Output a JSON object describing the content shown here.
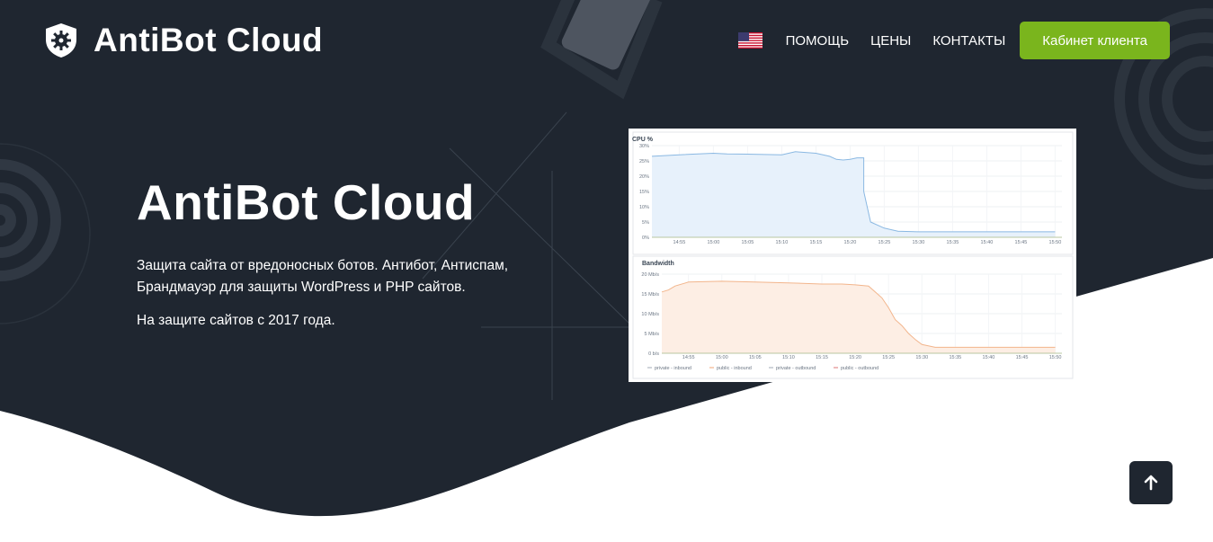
{
  "brand": {
    "name": "AntiBot Cloud",
    "icon": "shield-gear-icon"
  },
  "nav": {
    "language_icon": "us-flag-icon",
    "links": [
      "ПОМОЩЬ",
      "ЦЕНЫ",
      "КОНТАКТЫ"
    ],
    "cta_label": "Кабинет клиента"
  },
  "hero": {
    "title": "AntiBot Cloud",
    "description": "Защита сайта от вредоносных ботов. Антибот, Антиспам, Брандмауэр для защиты WordPress и PHP сайтов.",
    "since": "На защите сайтов с 2017 года."
  },
  "colors": {
    "dark_bg": "#1f2630",
    "accent": "#7ab51d",
    "text": "#ffffff"
  },
  "scroll_top": {
    "icon": "arrow-up-icon"
  },
  "chart_data": [
    {
      "type": "area",
      "title": "CPU %",
      "x_ticks": [
        "14:55",
        "15:00",
        "15:05",
        "15:10",
        "15:15",
        "15:20",
        "15:25",
        "15:30",
        "15:35",
        "15:40",
        "15:45",
        "15:50"
      ],
      "y_ticks": [
        "0%",
        "5%",
        "10%",
        "15%",
        "20%",
        "25%",
        "30%"
      ],
      "ylim": [
        0,
        30
      ],
      "grid": true,
      "series": [
        {
          "x": [
            "14:51",
            "14:55",
            "15:00",
            "15:02",
            "15:05",
            "15:10",
            "15:12",
            "15:15",
            "15:17",
            "15:18",
            "15:19",
            "15:20",
            "15:21",
            "15:22",
            "15:22",
            "15:23",
            "15:25",
            "15:27",
            "15:30",
            "15:50"
          ],
          "values": [
            26.5,
            27,
            27.5,
            27.3,
            27.2,
            27,
            28,
            27.5,
            26.5,
            25.5,
            25.3,
            25.5,
            26,
            26,
            15,
            5,
            3,
            2,
            1.8,
            1.8
          ]
        }
      ]
    },
    {
      "type": "area",
      "title": "Bandwidth",
      "x_ticks": [
        "14:55",
        "15:00",
        "15:05",
        "15:10",
        "15:15",
        "15:20",
        "15:25",
        "15:30",
        "15:35",
        "15:40",
        "15:45",
        "15:50"
      ],
      "y_ticks": [
        "0 b/s",
        "5 Mb/s",
        "10 Mb/s",
        "15 Mb/s",
        "20 Mb/s"
      ],
      "ylim": [
        0,
        20
      ],
      "grid": true,
      "legend": [
        "private - inbound",
        "public - inbound",
        "private - outbound",
        "public - outbound"
      ],
      "legend_position": "bottom",
      "series": [
        {
          "name": "public - inbound",
          "x": [
            "14:51",
            "14:52",
            "14:53",
            "14:55",
            "15:00",
            "15:05",
            "15:10",
            "15:15",
            "15:18",
            "15:20",
            "15:22",
            "15:23",
            "15:24",
            "15:25",
            "15:26",
            "15:27",
            "15:28",
            "15:29",
            "15:30",
            "15:32",
            "15:50"
          ],
          "values": [
            15.5,
            16,
            17,
            18,
            18.2,
            18,
            17.8,
            17.5,
            17.5,
            17.3,
            17,
            15.5,
            14,
            11.5,
            8.5,
            7,
            5,
            3.5,
            2.2,
            1.5,
            1.5
          ]
        }
      ]
    }
  ]
}
